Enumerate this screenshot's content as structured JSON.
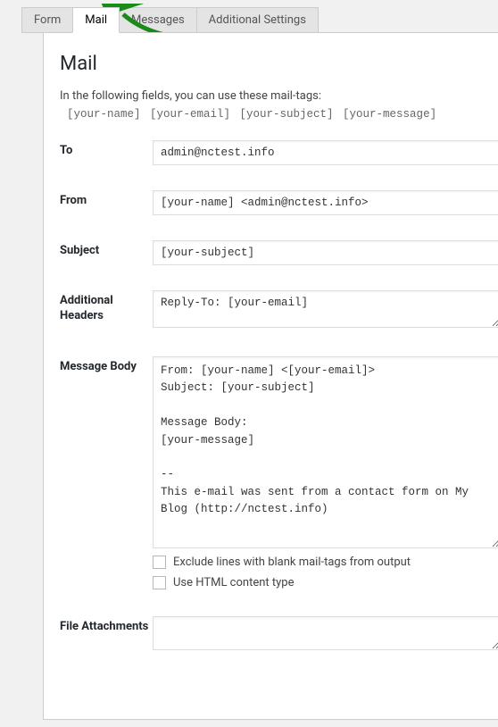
{
  "tabs": {
    "form": "Form",
    "mail": "Mail",
    "messages": "Messages",
    "additional": "Additional Settings"
  },
  "title": "Mail",
  "description": "In the following fields, you can use these mail-tags:",
  "mailtags": "[your-name] [your-email] [your-subject] [your-message]",
  "labels": {
    "to": "To",
    "from": "From",
    "subject": "Subject",
    "additional_headers": "Additional Headers",
    "message_body": "Message Body",
    "file_attachments": "File Attachments"
  },
  "fields": {
    "to": "admin@nctest.info",
    "from": "[your-name] <admin@nctest.info>",
    "subject": "[your-subject]",
    "additional_headers": "Reply-To: [your-email]",
    "message_body": "From: [your-name] <[your-email]>\nSubject: [your-subject]\n\nMessage Body:\n[your-message]\n\n--\nThis e-mail was sent from a contact form on My Blog (http://nctest.info)",
    "file_attachments": ""
  },
  "checkboxes": {
    "exclude_blank": "Exclude lines with blank mail-tags from output",
    "use_html": "Use HTML content type"
  }
}
